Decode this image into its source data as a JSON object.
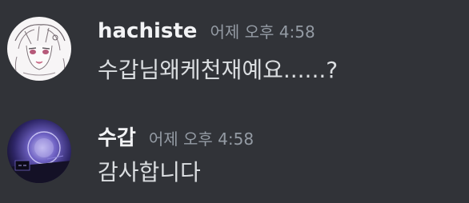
{
  "messages": [
    {
      "username": "hachiste",
      "timestamp": "어제 오후 4:58",
      "content": "수갑님왜케천재예요......?",
      "avatar_icon": "anime-character-sketch-avatar",
      "username_color": "#f2f3f5"
    },
    {
      "username": "수갑",
      "timestamp": "어제 오후 4:58",
      "content": "감사합니다",
      "avatar_icon": "purple-desk-scene-avatar",
      "username_color": "#f2f3f5"
    }
  ],
  "colors": {
    "background": "#313338",
    "text": "#dbdee1",
    "timestamp": "#949ba4"
  }
}
